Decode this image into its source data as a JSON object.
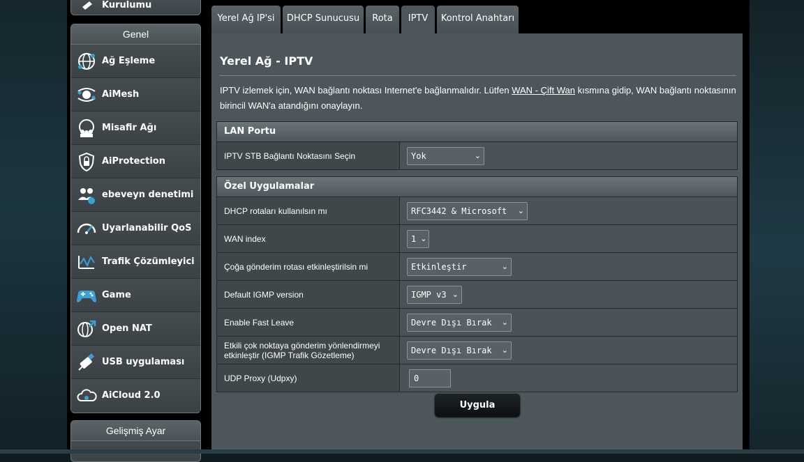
{
  "sidebar": {
    "top_item_label": "Kurulumu",
    "general_header": "Genel",
    "items": [
      {
        "label": "Ağ Eşleme",
        "icon": "network-map-icon"
      },
      {
        "label": "AiMesh",
        "icon": "aimesh-icon"
      },
      {
        "label": "Misafir Ağı",
        "icon": "guest-network-icon"
      },
      {
        "label": "AiProtection",
        "icon": "shield-lock-icon"
      },
      {
        "label": "ebeveyn denetimi",
        "icon": "parental-control-icon"
      },
      {
        "label": "Uyarlanabilir QoS",
        "icon": "speedometer-icon"
      },
      {
        "label": "Trafik Çözümleyici",
        "icon": "traffic-analyzer-icon"
      },
      {
        "label": "Game",
        "icon": "gamepad-icon"
      },
      {
        "label": "Open NAT",
        "icon": "open-nat-icon"
      },
      {
        "label": "USB uygulaması",
        "icon": "usb-icon"
      },
      {
        "label": "AiCloud 2.0",
        "icon": "cloud-icon"
      }
    ],
    "advanced_header": "Gelişmiş Ayar"
  },
  "tabs": [
    {
      "label": "Yerel Ağ IP'si"
    },
    {
      "label": "DHCP Sunucusu"
    },
    {
      "label": "Rota"
    },
    {
      "label": "IPTV",
      "active": true
    },
    {
      "label": "Kontrol Anahtarı"
    }
  ],
  "main": {
    "title": "Yerel Ağ - IPTV",
    "desc_part1": "IPTV izlemek için, WAN bağlantı noktası Internet'e bağlanmalıdır. Lütfen ",
    "desc_link": "WAN - Çift Wan",
    "desc_part2": " kısmına gidip, WAN bağlantı noktasının birincil WAN'a atandığını onaylayın.",
    "lan_section": {
      "header": "LAN Portu",
      "rows": [
        {
          "label": "IPTV STB Bağlantı Noktasını Seçin",
          "value": "Yok"
        }
      ]
    },
    "special_section": {
      "header": "Özel Uygulamalar",
      "rows": [
        {
          "label": "DHCP rotaları kullanılsın mı",
          "value": "RFC3442 & Microsoft"
        },
        {
          "label": "WAN index",
          "value": "1"
        },
        {
          "label": "Çoğa gönderim rotası etkinleştirilsin mi",
          "value": "Etkinleştir"
        },
        {
          "label": "Default IGMP version",
          "value": "IGMP v3"
        },
        {
          "label": "Enable Fast Leave",
          "value": "Devre Dışı Bırak"
        },
        {
          "label": "Etkili çok noktaya gönderim yönlendirmeyi etkinleştir (IGMP Trafik Gözetleme)",
          "value": "Devre Dışı Bırak"
        },
        {
          "label": "UDP Proxy (Udpxy)",
          "value": "0"
        }
      ]
    },
    "apply_label": "Uygula"
  }
}
